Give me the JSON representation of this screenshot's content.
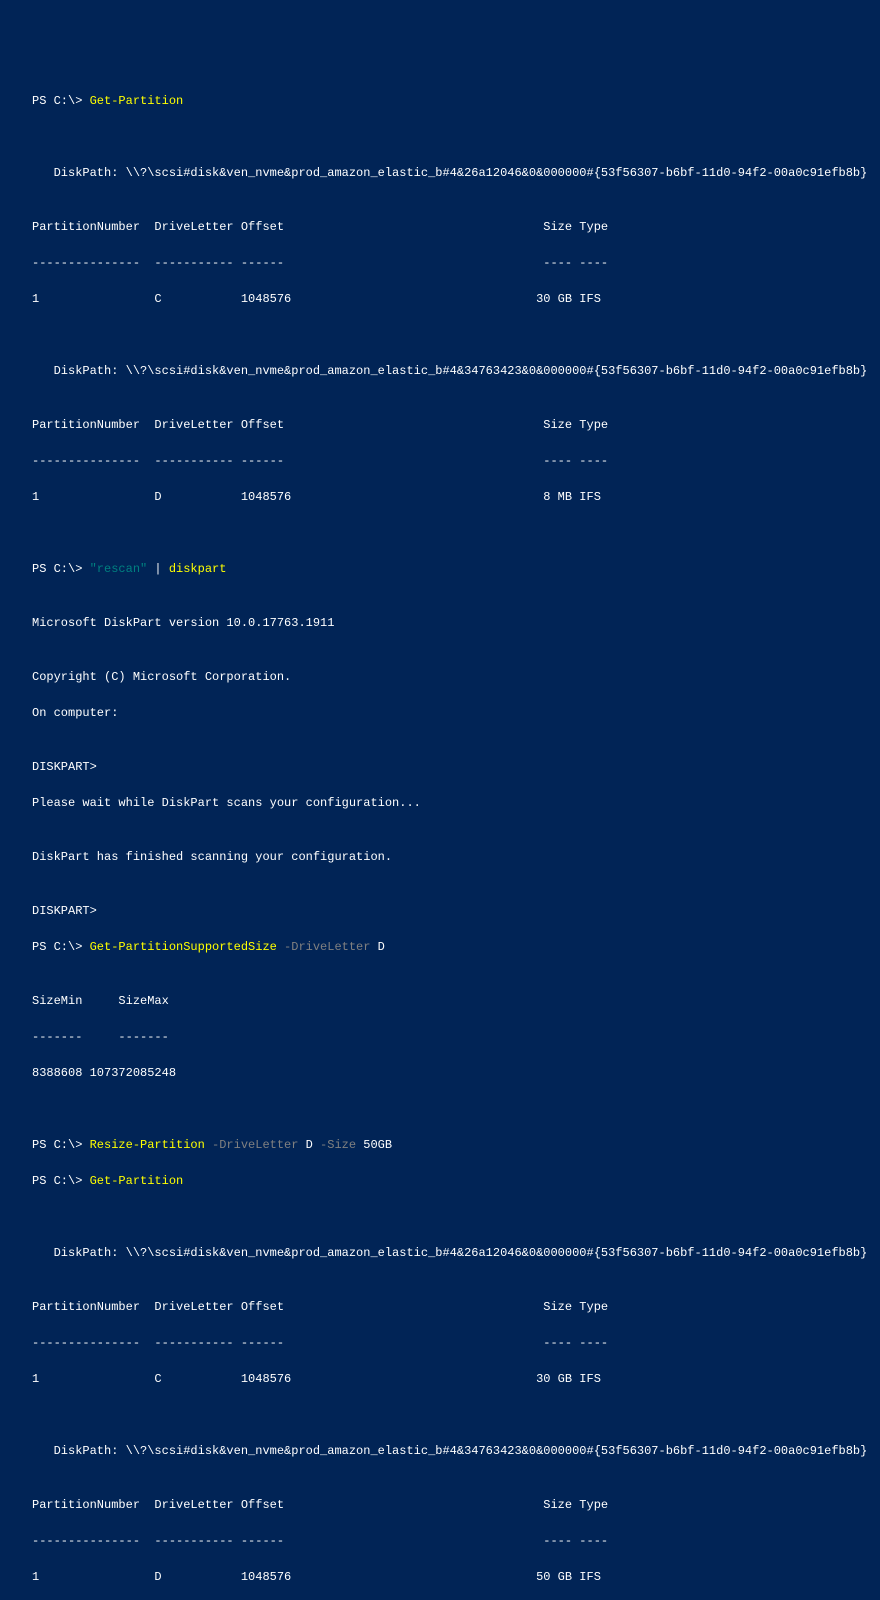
{
  "prompt": "PS C:\\> ",
  "cmd1": "Get-Partition",
  "blank": "",
  "disk1_header": "   DiskPath: \\\\?\\scsi#disk&ven_nvme&prod_amazon_elastic_b#4&26a12046&0&000000#{53f56307-b6bf-11d0-94f2-00a0c91efb8b}",
  "table_header": "PartitionNumber  DriveLetter Offset                                    Size Type",
  "table_divider": "---------------  ----------- ------                                    ---- ----",
  "disk1_row": "1                C           1048576                                  30 GB IFS",
  "disk2_header": "   DiskPath: \\\\?\\scsi#disk&ven_nvme&prod_amazon_elastic_b#4&34763423&0&000000#{53f56307-b6bf-11d0-94f2-00a0c91efb8b}",
  "disk2_row": "1                D           1048576                                   8 MB IFS",
  "cmd2_string": "\"rescan\"",
  "cmd2_pipe": " | ",
  "cmd2_cmd": "diskpart",
  "diskpart_version": "Microsoft DiskPart version 10.0.17763.1911",
  "diskpart_copyright": "Copyright (C) Microsoft Corporation.",
  "diskpart_computer": "On computer:",
  "diskpart_prompt": "DISKPART>",
  "diskpart_wait": "Please wait while DiskPart scans your configuration...",
  "diskpart_done": "DiskPart has finished scanning your configuration.",
  "cmd3": "Get-PartitionSupportedSize",
  "cmd3_param": " -DriveLetter",
  "cmd3_val": " D",
  "size_header": "SizeMin     SizeMax",
  "size_divider": "-------     -------",
  "size_row": "8388608 107372085248",
  "cmd4": "Resize-Partition",
  "cmd4_param1": " -DriveLetter",
  "cmd4_val1": " D",
  "cmd4_param2": " -Size",
  "cmd4_val2": " 50GB",
  "cmd5": "Get-Partition",
  "disk2_row_after": "1                D           1048576                                  50 GB IFS"
}
